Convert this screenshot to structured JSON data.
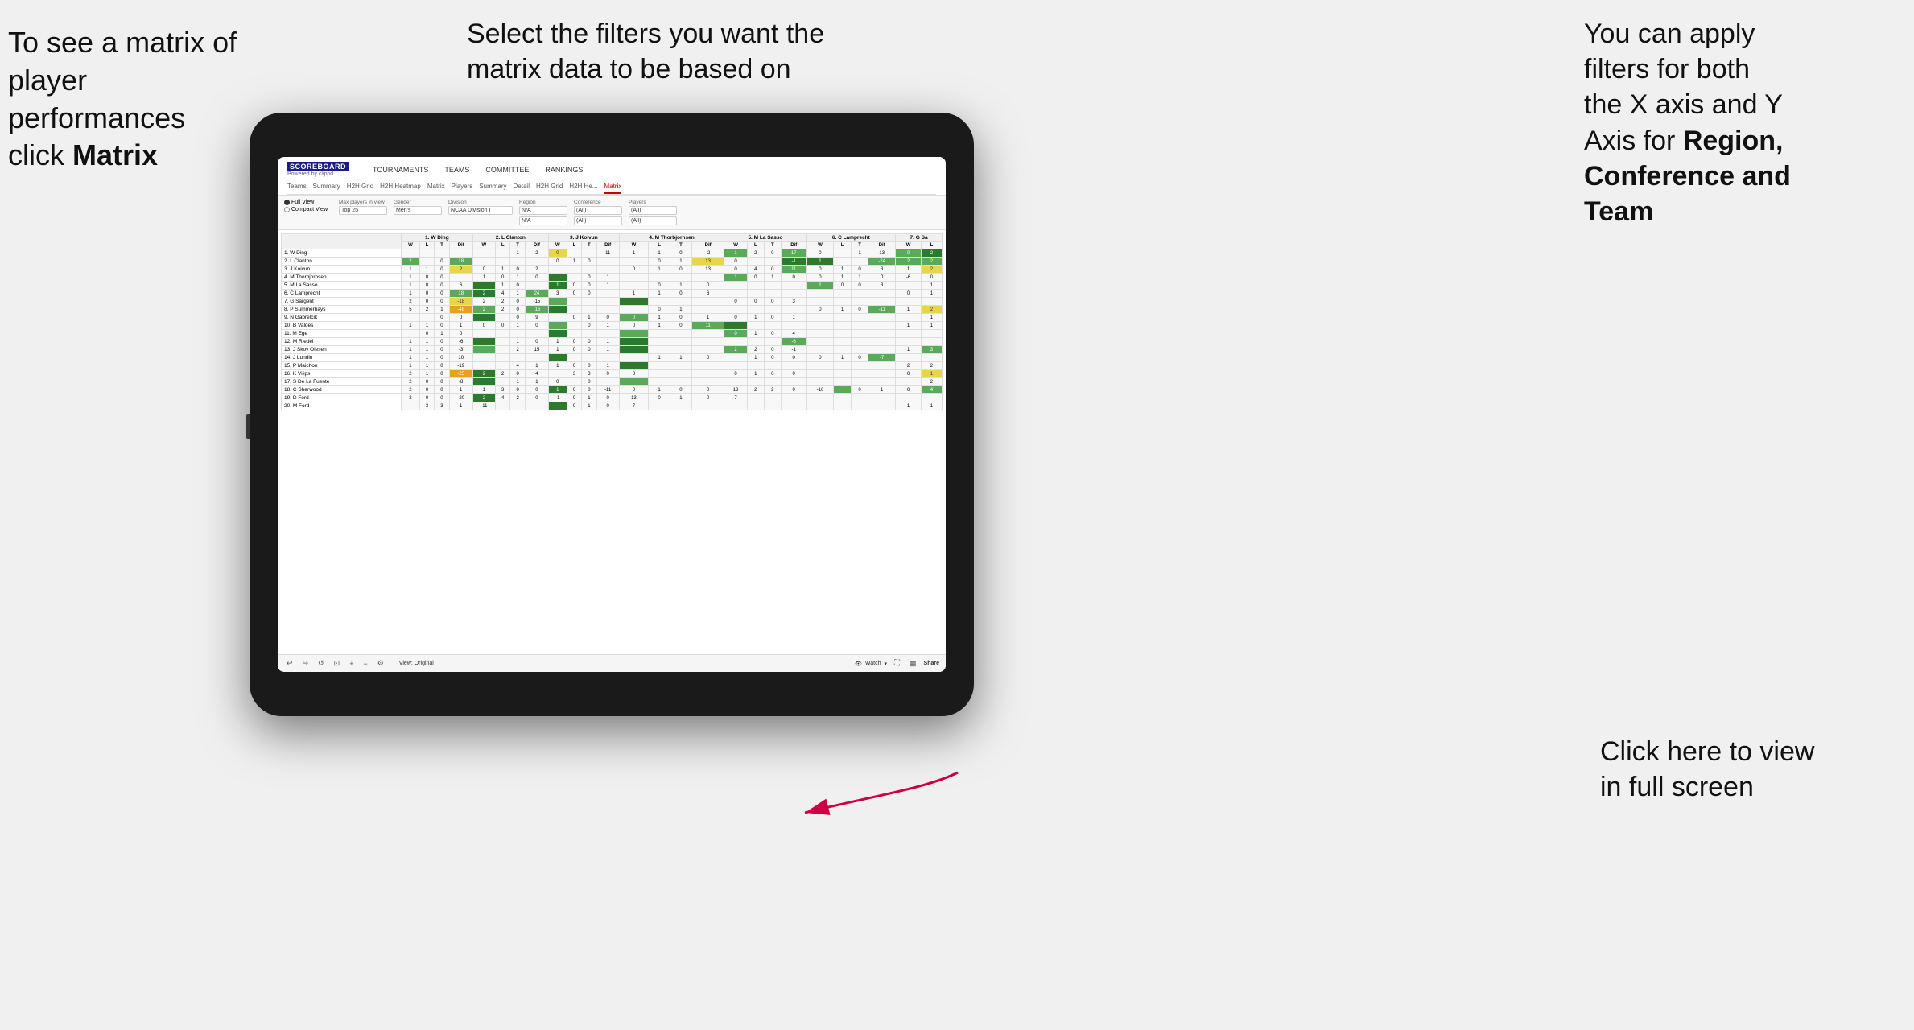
{
  "annotations": {
    "top_left": {
      "line1": "To see a matrix of",
      "line2": "player performances",
      "line3": "click ",
      "bold": "Matrix"
    },
    "top_center": {
      "text": "Select the filters you want the matrix data to be based on"
    },
    "top_right": {
      "line1": "You  can apply",
      "line2": "filters for both",
      "line3": "the X axis and Y",
      "line4": "Axis for ",
      "bold1": "Region,",
      "line5": "",
      "bold2": "Conference and",
      "line6": "",
      "bold3": "Team"
    },
    "bottom_right": {
      "line1": "Click here to view",
      "line2": "in full screen"
    }
  },
  "scoreboard": {
    "logo": "SCOREBOARD",
    "logo_sub": "Powered by clippd",
    "nav_items": [
      "TOURNAMENTS",
      "TEAMS",
      "COMMITTEE",
      "RANKINGS"
    ],
    "sub_tabs": [
      "Teams",
      "Summary",
      "H2H Grid",
      "H2H Heatmap",
      "Matrix",
      "Players",
      "Summary",
      "Detail",
      "H2H Grid",
      "H2H He...",
      "Matrix"
    ],
    "active_tab": "Matrix",
    "filters": {
      "views": [
        "Full View",
        "Compact View"
      ],
      "active_view": "Full View",
      "max_players_label": "Max players in view",
      "max_players_value": "Top 25",
      "gender_label": "Gender",
      "gender_value": "Men's",
      "division_label": "Division",
      "division_value": "NCAA Division I",
      "region_label": "Region",
      "region_value": "N/A",
      "conference_label": "Conference",
      "conference_value": "(All)",
      "conference_value2": "(All)",
      "players_label": "Players",
      "players_value": "(All)",
      "players_value2": "(All)"
    },
    "column_headers": [
      "1. W Ding",
      "2. L Clanton",
      "3. J Koivun",
      "4. M Thorbjornsen",
      "5. M La Sasso",
      "6. C Lamprecht",
      "7. G Sa"
    ],
    "sub_headers": [
      "W",
      "L",
      "T",
      "Dif"
    ],
    "players": [
      {
        "name": "1. W Ding",
        "row": 1
      },
      {
        "name": "2. L Clanton",
        "row": 2
      },
      {
        "name": "3. J Koivun",
        "row": 3
      },
      {
        "name": "4. M Thorbjornsen",
        "row": 4
      },
      {
        "name": "5. M La Sasso",
        "row": 5
      },
      {
        "name": "6. C Lamprecht",
        "row": 6
      },
      {
        "name": "7. G Sargent",
        "row": 7
      },
      {
        "name": "8. P Summerhays",
        "row": 8
      },
      {
        "name": "9. N Gabrelcik",
        "row": 9
      },
      {
        "name": "10. B Valdes",
        "row": 10
      },
      {
        "name": "11. M Ege",
        "row": 11
      },
      {
        "name": "12. M Riedel",
        "row": 12
      },
      {
        "name": "13. J Skov Olesen",
        "row": 13
      },
      {
        "name": "14. J Lundin",
        "row": 14
      },
      {
        "name": "15. P Maichon",
        "row": 15
      },
      {
        "name": "16. K Vilips",
        "row": 16
      },
      {
        "name": "17. S De La Fuente",
        "row": 17
      },
      {
        "name": "18. C Sherwood",
        "row": 18
      },
      {
        "name": "19. D Ford",
        "row": 19
      },
      {
        "name": "20. M Ford",
        "row": 20
      }
    ],
    "toolbar": {
      "view_label": "View: Original",
      "watch_label": "Watch",
      "share_label": "Share"
    }
  }
}
